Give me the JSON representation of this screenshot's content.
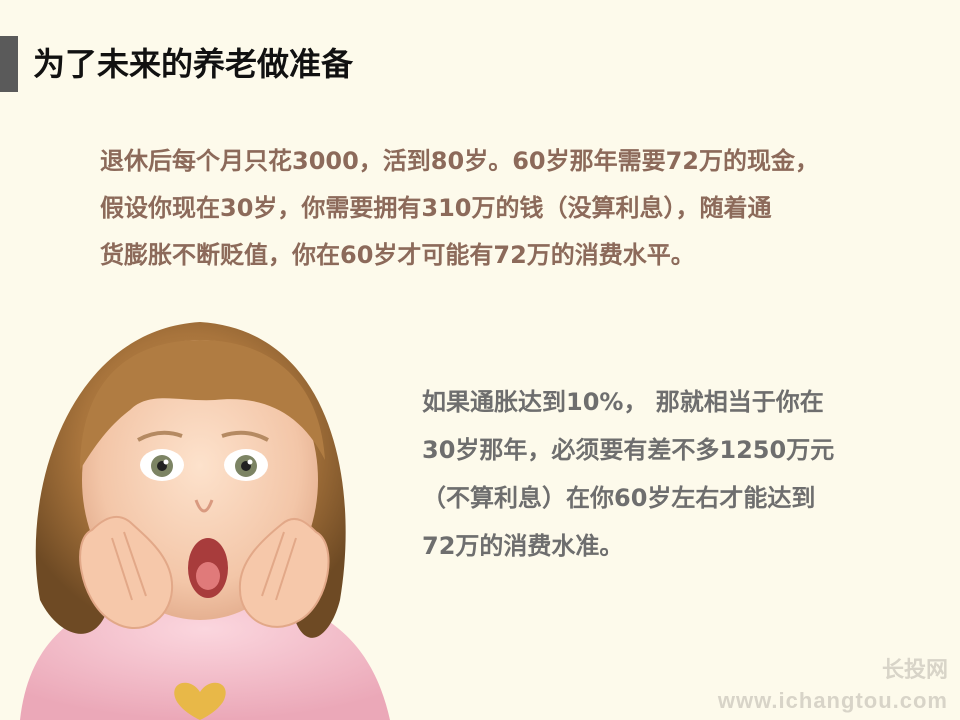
{
  "slide": {
    "title": "为了未来的养老做准备",
    "paragraph1": [
      "退休后每个月只花3000，活到80岁。60岁那年需要72万的现金，",
      "假设你现在30岁，你需要拥有310万的钱（没算利息），随着通",
      "货膨胀不断贬值，你在60岁才可能有72万的消费水平。"
    ],
    "paragraph2": [
      "如果通胀达到10%， 那就相当于你在",
      "30岁那年，必须要有差不多1250万元",
      "（不算利息）在你60岁左右才能达到",
      "72万的消费水准。"
    ],
    "watermark": {
      "site_name": "长投网",
      "url": "www.ichangtou.com"
    }
  },
  "colors": {
    "background": "#fdfaeb",
    "title_bar": "#5a5a5a",
    "title_text": "#111111",
    "paragraph1_text": "#8c6a5a",
    "paragraph2_text": "#6e6e6e",
    "watermark": "#d8d4c8"
  }
}
